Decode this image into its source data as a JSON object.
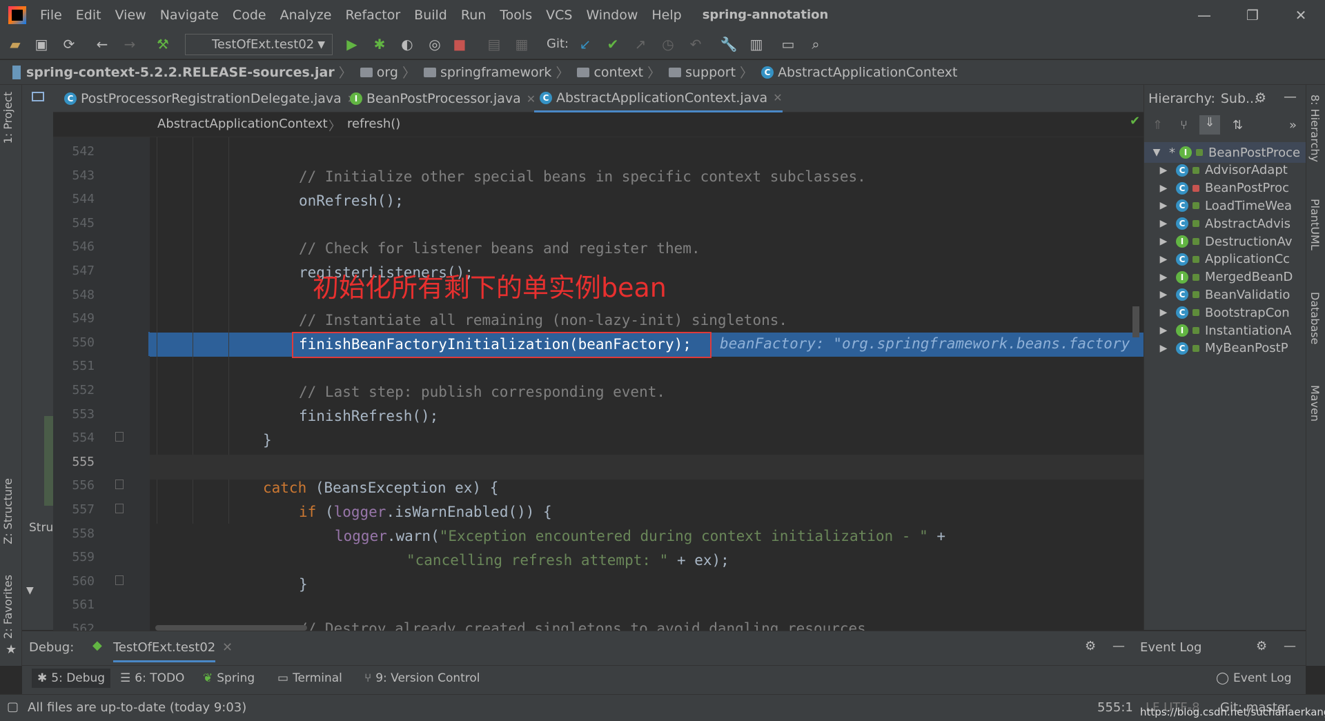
{
  "menubar": {
    "items": [
      "File",
      "Edit",
      "View",
      "Navigate",
      "Code",
      "Analyze",
      "Refactor",
      "Build",
      "Run",
      "Tools",
      "VCS",
      "Window",
      "Help"
    ],
    "project_title": "spring-annotation"
  },
  "toolbar": {
    "run_config": "TestOfExt.test02",
    "git_label": "Git:"
  },
  "navbar": {
    "crumbs": [
      "spring-context-5.2.2.RELEASE-sources.jar",
      "org",
      "springframework",
      "context",
      "support",
      "AbstractApplicationContext"
    ]
  },
  "left_strip": {
    "project": "1: Project",
    "structure": "Z: Structure",
    "favorites": "2: Favorites",
    "stru_label": "Stru"
  },
  "editor_tabs": [
    {
      "label": "PostProcessorRegistrationDelegate.java",
      "icon": "class-icon"
    },
    {
      "label": "BeanPostProcessor.java",
      "icon": "interface-icon"
    },
    {
      "label": "AbstractApplicationContext.java",
      "icon": "class-icon"
    }
  ],
  "editor_crumbs": {
    "class": "AbstractApplicationContext",
    "method": "refresh()"
  },
  "gutter": {
    "line_numbers": [
      "542",
      "543",
      "544",
      "545",
      "546",
      "547",
      "548",
      "549",
      "550",
      "551",
      "552",
      "553",
      "554",
      "555",
      "556",
      "557",
      "558",
      "559",
      "560",
      "561",
      "562"
    ]
  },
  "code": {
    "l543": "// Initialize other special beans in specific context subclasses.",
    "l544": "onRefresh();",
    "l546": "// Check for listener beans and register them.",
    "l547": "registerListeners();",
    "l549": "// Instantiate all remaining (non-lazy-init) singletons.",
    "l550": "finishBeanFactoryInitialization(beanFactory);",
    "l550_inline": "beanFactory: \"org.springframework.beans.factory",
    "l552": "// Last step: publish corresponding event.",
    "l553": "finishRefresh();",
    "l554": "}",
    "l556_kw": "catch",
    "l556_rest": " (BeansException ex) {",
    "l557_kw": "if",
    "l557_fld": "logger",
    "l557_rest": ".isWarnEnabled()) {",
    "l558_fld": "logger",
    "l558_call": ".warn(",
    "l558_str": "\"Exception encountered during context initialization - \"",
    "l558_tail": " +",
    "l559_str": "\"cancelling refresh attempt: \"",
    "l559_tail": " + ex);",
    "l560": "}",
    "l562": "// Destroy already created singletons to avoid dangling resources."
  },
  "annotation": "初始化所有剩下的单实例bean",
  "hierarchy": {
    "title": "Hierarchy:",
    "scope": "Sub...",
    "items": [
      {
        "label": "BeanPostProce",
        "icon": "interface",
        "root": true
      },
      {
        "label": "AdvisorAdapt",
        "icon": "class"
      },
      {
        "label": "BeanPostProc",
        "icon": "class",
        "lock": "red"
      },
      {
        "label": "LoadTimeWea",
        "icon": "class"
      },
      {
        "label": "AbstractAdvis",
        "icon": "class"
      },
      {
        "label": "DestructionAv",
        "icon": "interface"
      },
      {
        "label": "ApplicationCc",
        "icon": "class"
      },
      {
        "label": "MergedBeanD",
        "icon": "interface"
      },
      {
        "label": "BeanValidatio",
        "icon": "class"
      },
      {
        "label": "BootstrapCon",
        "icon": "class"
      },
      {
        "label": "InstantiationA",
        "icon": "interface"
      },
      {
        "label": "MyBeanPostP",
        "icon": "class"
      }
    ]
  },
  "right_strip": {
    "hierarchy": "8: Hierarchy",
    "plantuml": "PlantUML",
    "database": "Database",
    "maven": "Maven"
  },
  "debug_bar": {
    "label": "Debug:",
    "session": "TestOfExt.test02",
    "event_log": "Event Log"
  },
  "bottom_tabs": [
    "5: Debug",
    "6: TODO",
    "Spring",
    "Terminal",
    "9: Version Control"
  ],
  "event_log_button": "Event Log",
  "status": {
    "message": "All files are up-to-date (today 9:03)",
    "position": "555:1",
    "encoding": "LF  UTF-8",
    "git": "Git: master",
    "watermark": "https://blog.csdn.net/suchahaerkang"
  }
}
